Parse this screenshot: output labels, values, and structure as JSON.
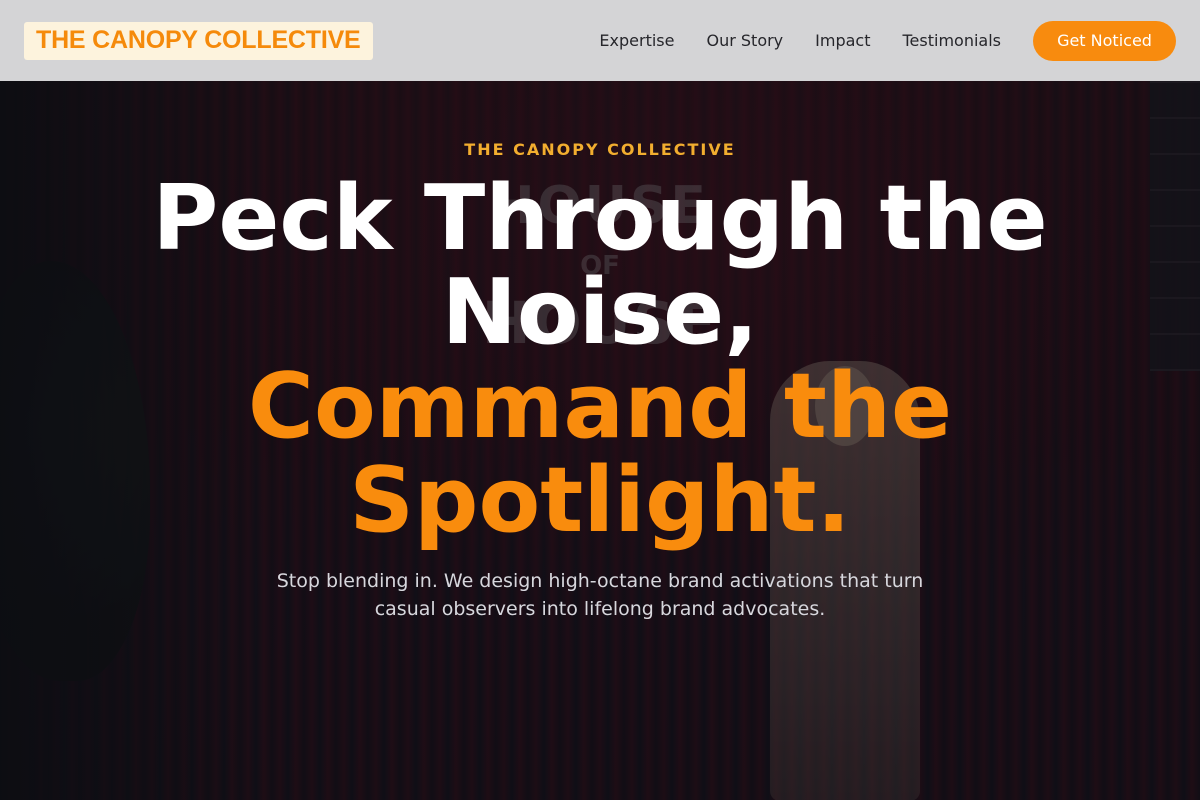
{
  "header": {
    "logo": "THE CANOPY COLLECTIVE",
    "nav": [
      "Expertise",
      "Our Story",
      "Impact",
      "Testimonials"
    ],
    "cta_label": "Get Noticed"
  },
  "hero": {
    "eyebrow": "THE CANOPY COLLECTIVE",
    "headline_line1": "Peck Through the",
    "headline_line2": "Noise,",
    "headline_line3": "Command the",
    "headline_line4": "Spotlight.",
    "subtext": "Stop blending in. We design high-octane brand activations that turn casual observers into lifelong brand advocates.",
    "background_sign": [
      "HOUSE",
      "OF",
      "HOUSE"
    ]
  },
  "colors": {
    "accent": "#f88b0e",
    "eyebrow": "#f2ae2f",
    "header_bg": "#d4d4d6",
    "logo_bg": "#fdf3dd"
  }
}
